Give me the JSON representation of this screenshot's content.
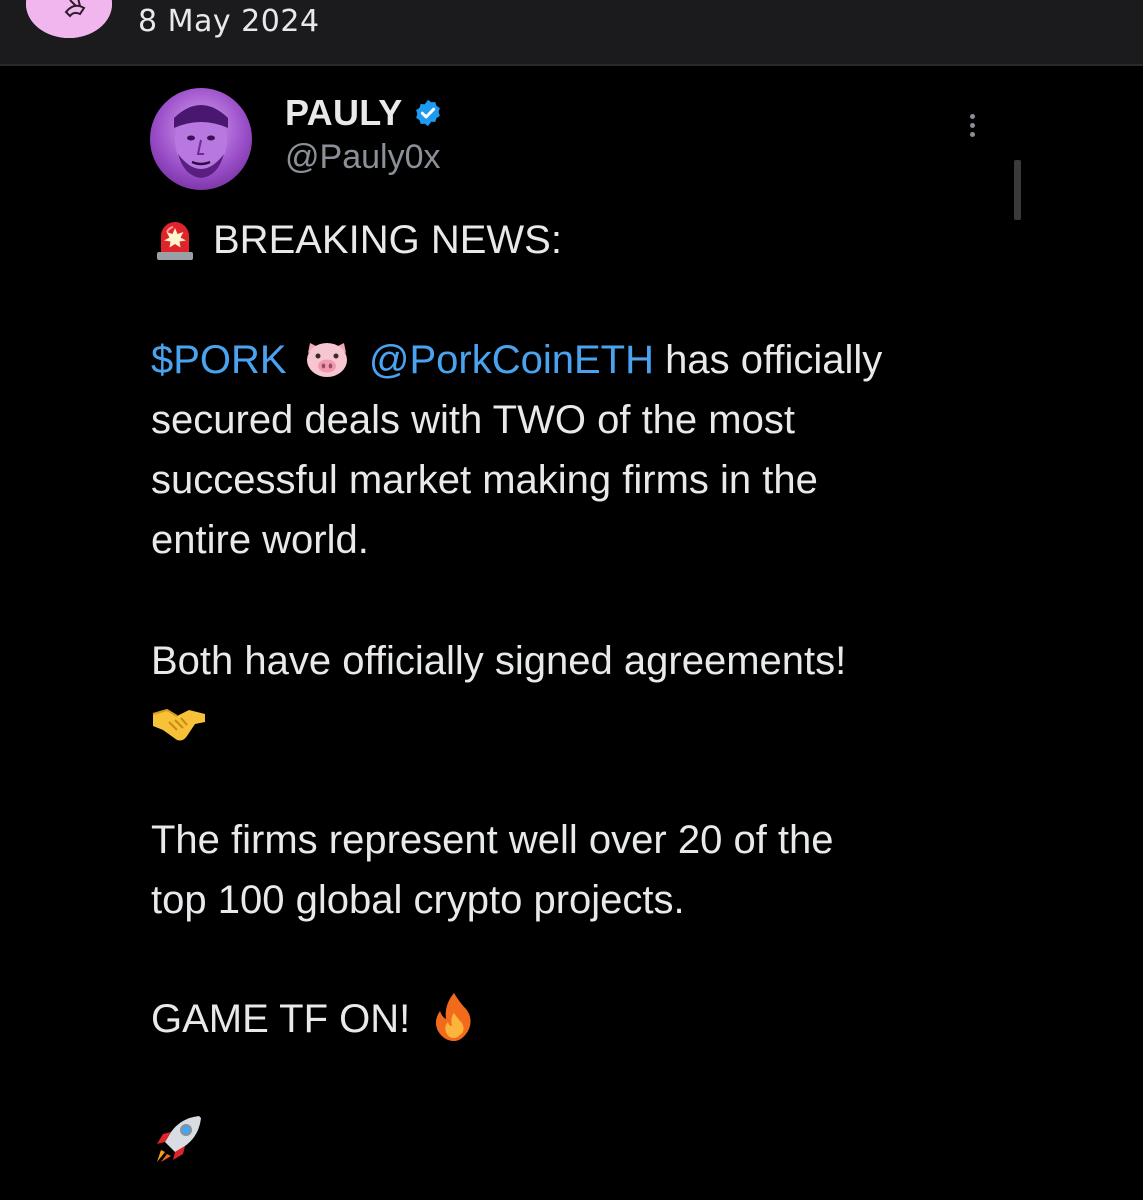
{
  "header": {
    "date": "8 May 2024"
  },
  "tweet": {
    "author_name": "PAULY",
    "author_handle": "@Pauly0x",
    "lines": {
      "breaking": "BREAKING NEWS:",
      "ticker": "$PORK",
      "mention": "@PorkCoinETH",
      "l1_rest": " has officially",
      "l2": "secured deals with TWO of the most",
      "l3": "successful market making firms in the",
      "l4": "entire world.",
      "l5": "Both have officially signed agreements!",
      "l6": "The firms represent well over 20 of the",
      "l7": "top 100 global crypto projects.",
      "l8": "GAME TF ON!"
    },
    "icons": {
      "siren": "police-siren-emoji",
      "pig": "pig-face-emoji",
      "handshake": "handshake-emoji",
      "fire": "fire-emoji",
      "rocket": "rocket-emoji",
      "verified": "verified-badge-icon",
      "more": "more-options-icon"
    },
    "colors": {
      "link": "#4aa3f0",
      "verified": "#1d9bf0",
      "text": "#e7e9ea",
      "muted": "#8b9098"
    }
  }
}
